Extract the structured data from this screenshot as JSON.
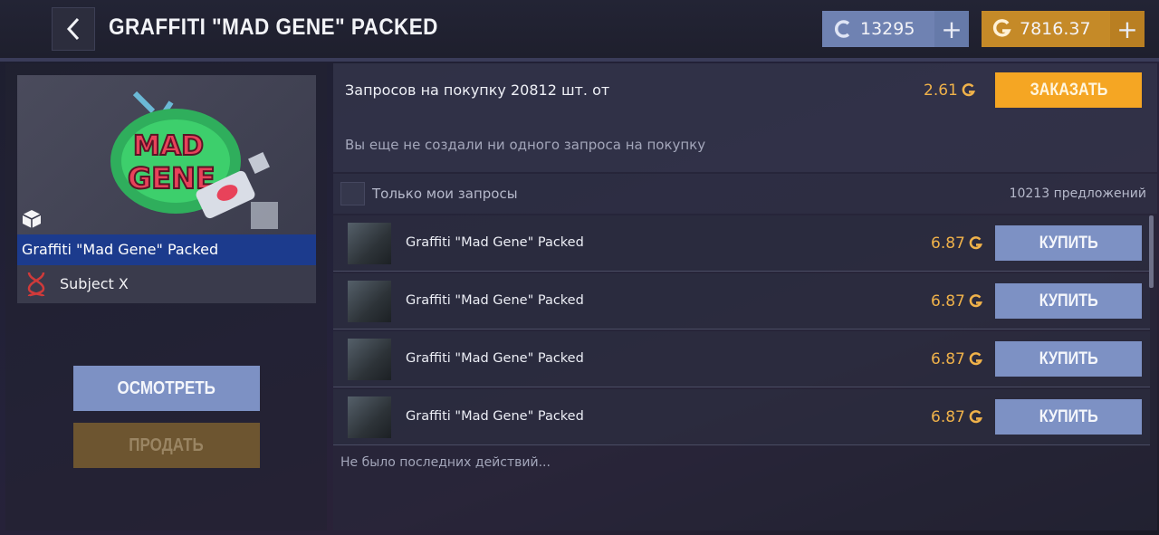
{
  "header": {
    "title": "GRAFFITI \"MAD GENE\" PACKED",
    "silver_balance": "13295",
    "gold_balance": "7816.37"
  },
  "item": {
    "name": "Graffiti \"Mad Gene\" Packed",
    "collection": "Subject X",
    "inspect_label": "ОСМОТРЕТЬ",
    "sell_label": "ПРОДАТЬ"
  },
  "requests": {
    "label": "Запросов на покупку 20812 шт. от",
    "price": "2.61",
    "order_label": "ЗАКАЗАТЬ",
    "empty_text": "Вы еще не создали ни одного запроса на покупку"
  },
  "filter": {
    "label": "Только мои запросы",
    "offers_count": "10213 предложений"
  },
  "listings": [
    {
      "name": "Graffiti \"Mad Gene\" Packed",
      "price": "6.87",
      "buy_label": "КУПИТЬ"
    },
    {
      "name": "Graffiti \"Mad Gene\" Packed",
      "price": "6.87",
      "buy_label": "КУПИТЬ"
    },
    {
      "name": "Graffiti \"Mad Gene\" Packed",
      "price": "6.87",
      "buy_label": "КУПИТЬ"
    },
    {
      "name": "Graffiti \"Mad Gene\" Packed",
      "price": "6.87",
      "buy_label": "КУПИТЬ"
    }
  ],
  "recent_text": "Не было последних действий...",
  "colors": {
    "silver": "#6f82b2",
    "gold": "#c58a28",
    "accent_orange": "#f5a623",
    "buy_blue": "#7d91c4",
    "selected_blue": "#1c3b8d",
    "price_gold": "#f0b24a"
  }
}
